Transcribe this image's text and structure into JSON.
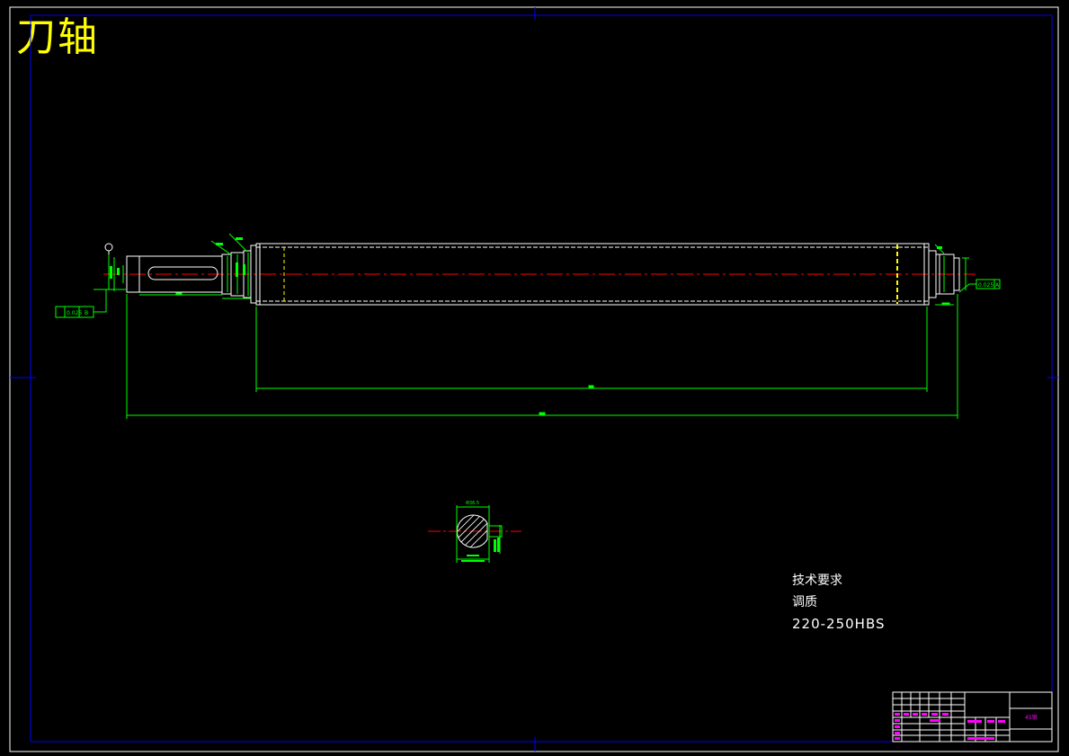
{
  "drawing": {
    "title": "刀轴",
    "technical_requirements": {
      "heading": "技术要求",
      "treatment": "调质",
      "hardness": "220-250HBS"
    },
    "left_tolerance": "0.025",
    "left_datum": "B",
    "right_tolerance": "0.025",
    "right_datum": "A",
    "section_width_dim": "Φ36.5",
    "title_block_material": "45钢"
  },
  "colors": {
    "background": "#000000",
    "frame": "#0000ff",
    "part_outline": "#ffffff",
    "hidden_lines": "#ffff00",
    "center_line": "#ff0000",
    "dimensions": "#00ff00",
    "title_block_text": "#ff00ff",
    "title_text": "#ffff00"
  }
}
